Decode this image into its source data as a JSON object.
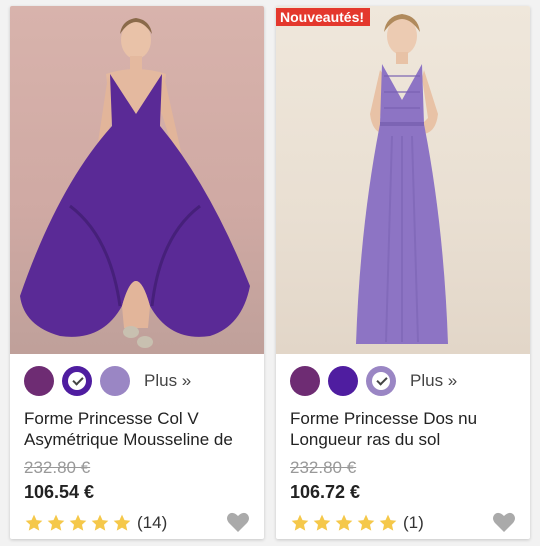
{
  "products": [
    {
      "title": "Forme Princesse Col V Asymétrique Mousseline de",
      "old_price": "232.80 €",
      "price": "106.54 €",
      "review_count": "(14)",
      "rating": 5,
      "more_label": "Plus »",
      "badge": "",
      "dress_color": "#5a2a96",
      "swatches": [
        {
          "color": "#6e2c73",
          "selected": false
        },
        {
          "color": "#4f1da0",
          "selected": true
        },
        {
          "color": "#9a86c4",
          "selected": false
        }
      ]
    },
    {
      "title": "Forme Princesse Dos nu Longueur ras du sol",
      "old_price": "232.80 €",
      "price": "106.72 €",
      "review_count": "(1)",
      "rating": 5,
      "more_label": "Plus »",
      "badge": "Nouveautés!",
      "dress_color": "#8d74c4",
      "swatches": [
        {
          "color": "#6e2c73",
          "selected": false
        },
        {
          "color": "#4f1da0",
          "selected": false
        },
        {
          "color": "#9a86c4",
          "selected": true
        }
      ]
    }
  ],
  "colors": {
    "star": "#f5c84a",
    "heart": "#aaaaaa",
    "badge": "#e4382d"
  }
}
